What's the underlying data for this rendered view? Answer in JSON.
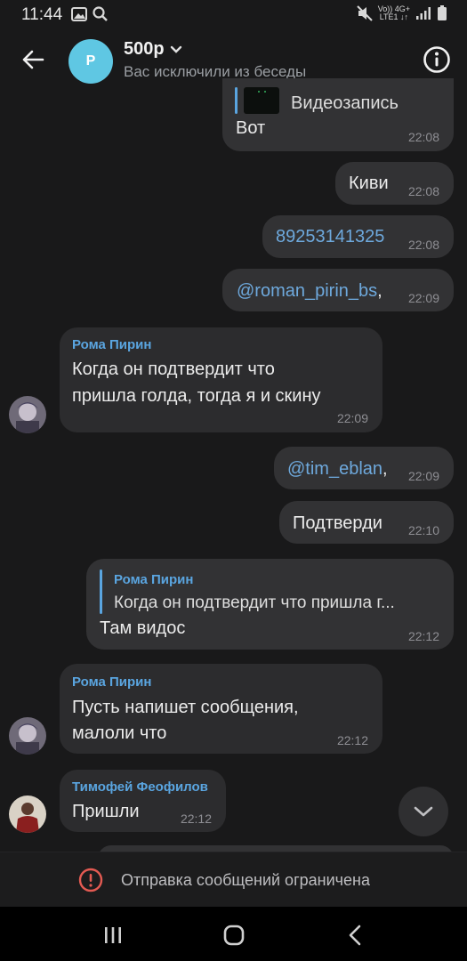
{
  "status_bar": {
    "time": "11:44",
    "network_top": "Vo)) 4G+",
    "network_bottom": "LTE1 ↓↑"
  },
  "header": {
    "avatar_letter": "P",
    "title": "500р",
    "subtitle": "Вас исключили из беседы"
  },
  "messages": {
    "m1": {
      "reply_label": "Видеозапись",
      "text": "Вот",
      "time": "22:08"
    },
    "m2": {
      "text": "Киви",
      "time": "22:08"
    },
    "m3": {
      "text": "89253141325",
      "time": "22:08"
    },
    "m4": {
      "text": "@roman_pirin_bs",
      "suffix": ",",
      "time": "22:09"
    },
    "m5": {
      "sender": "Рома Пирин",
      "line1": "Когда он подтвердит что",
      "line2": "пришла голда, тогда я и скину",
      "time": "22:09"
    },
    "m6": {
      "text": "@tim_eblan",
      "suffix": ",",
      "time": "22:09"
    },
    "m7": {
      "text": "Подтверди",
      "time": "22:10"
    },
    "m8": {
      "reply_name": "Рома Пирин",
      "reply_text": "Когда он подтвердит что пришла г...",
      "text": "Там видос",
      "time": "22:12"
    },
    "m9": {
      "sender": "Рома Пирин",
      "line1": "Пусть напишет сообщения,",
      "line2": "малоли что",
      "time": "22:12"
    },
    "m10": {
      "sender": "Тимофей Феофилов",
      "text": "Пришли",
      "time": "22:12"
    }
  },
  "restriction": {
    "text": "Отправка сообщений ограничена"
  },
  "icons": {
    "back": "arrow-left-icon",
    "info": "info-circle-icon",
    "scroll_down": "chevron-down-icon",
    "restricted": "exclamation-circle-icon",
    "nav_recents": "recents-icon",
    "nav_home": "home-icon",
    "nav_back": "nav-back-icon"
  },
  "colors": {
    "background": "#19191a",
    "bubble": "#2c2c2e",
    "accent": "#5aa5e0",
    "link": "#6ea9dd",
    "warning": "#e35a52",
    "chat_avatar": "#5fc7e3"
  }
}
